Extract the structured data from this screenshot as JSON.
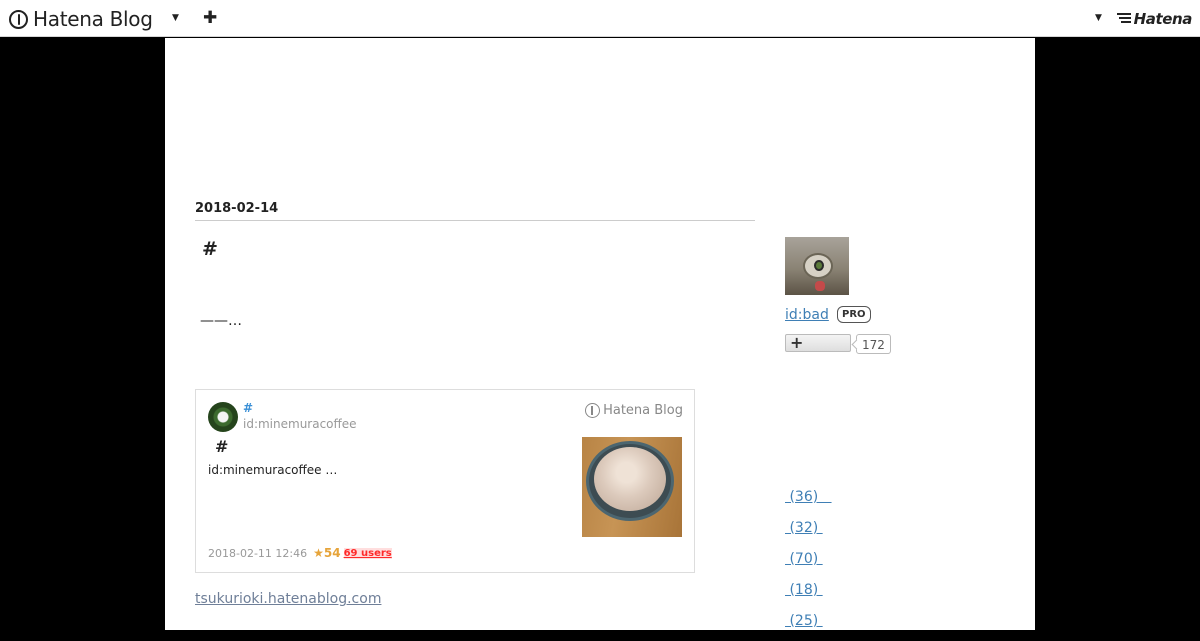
{
  "header": {
    "brand": "Hatena Blog",
    "hatena": "Hatena"
  },
  "entry": {
    "date": "2018-02-14",
    "title": "#",
    "body": "——…",
    "card": {
      "title": "#",
      "user": "id:minemuracoffee",
      "brand": "Hatena Blog",
      "heading": "#",
      "excerpt": "id:minemuracoffee …",
      "timestamp": "2018-02-11 12:46",
      "stars": "★54",
      "bookmarks": "69 users"
    },
    "source": "tsukurioki.hatenablog.com"
  },
  "sidebar": {
    "profile_id": "id:bad",
    "pro": "PRO",
    "follow_count": "172",
    "categories": [
      {
        "label": " (36)   "
      },
      {
        "label": " (32) "
      },
      {
        "label": " (70) "
      },
      {
        "label": " (18) "
      },
      {
        "label": " (25) "
      }
    ]
  }
}
